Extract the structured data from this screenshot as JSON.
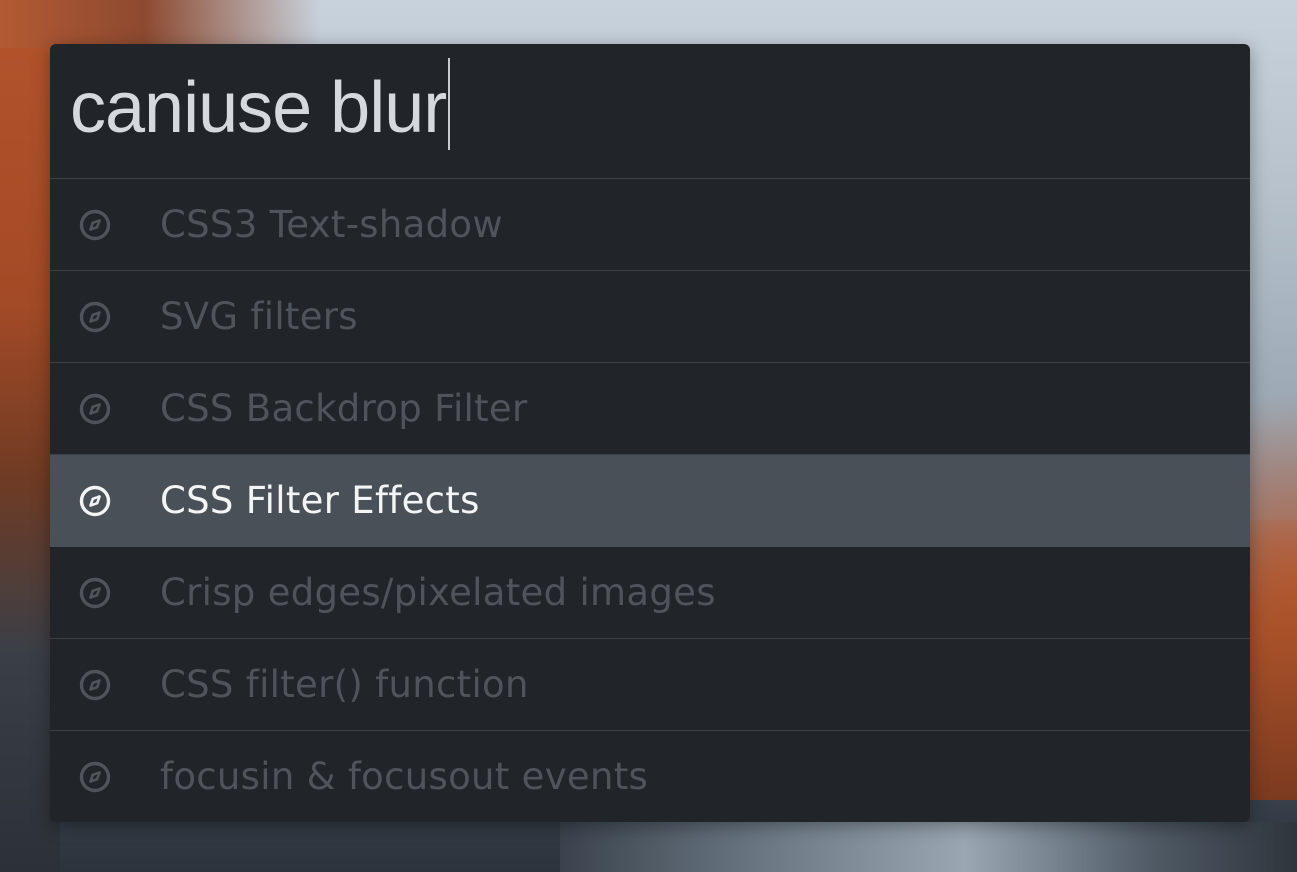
{
  "search": {
    "query": "caniuse blur"
  },
  "results": [
    {
      "label": "CSS3 Text-shadow",
      "icon": "compass-icon",
      "selected": false
    },
    {
      "label": "SVG filters",
      "icon": "compass-icon",
      "selected": false
    },
    {
      "label": "CSS Backdrop Filter",
      "icon": "compass-icon",
      "selected": false
    },
    {
      "label": "CSS Filter Effects",
      "icon": "compass-icon",
      "selected": true
    },
    {
      "label": "Crisp edges/pixelated images",
      "icon": "compass-icon",
      "selected": false
    },
    {
      "label": "CSS filter() function",
      "icon": "compass-icon",
      "selected": false
    },
    {
      "label": "focusin & focusout events",
      "icon": "compass-icon",
      "selected": false
    }
  ],
  "colors": {
    "panel_bg": "#212429",
    "selected_bg": "#4a5058",
    "dim_text": "#4f545b",
    "selected_text": "#f2f4f6"
  }
}
